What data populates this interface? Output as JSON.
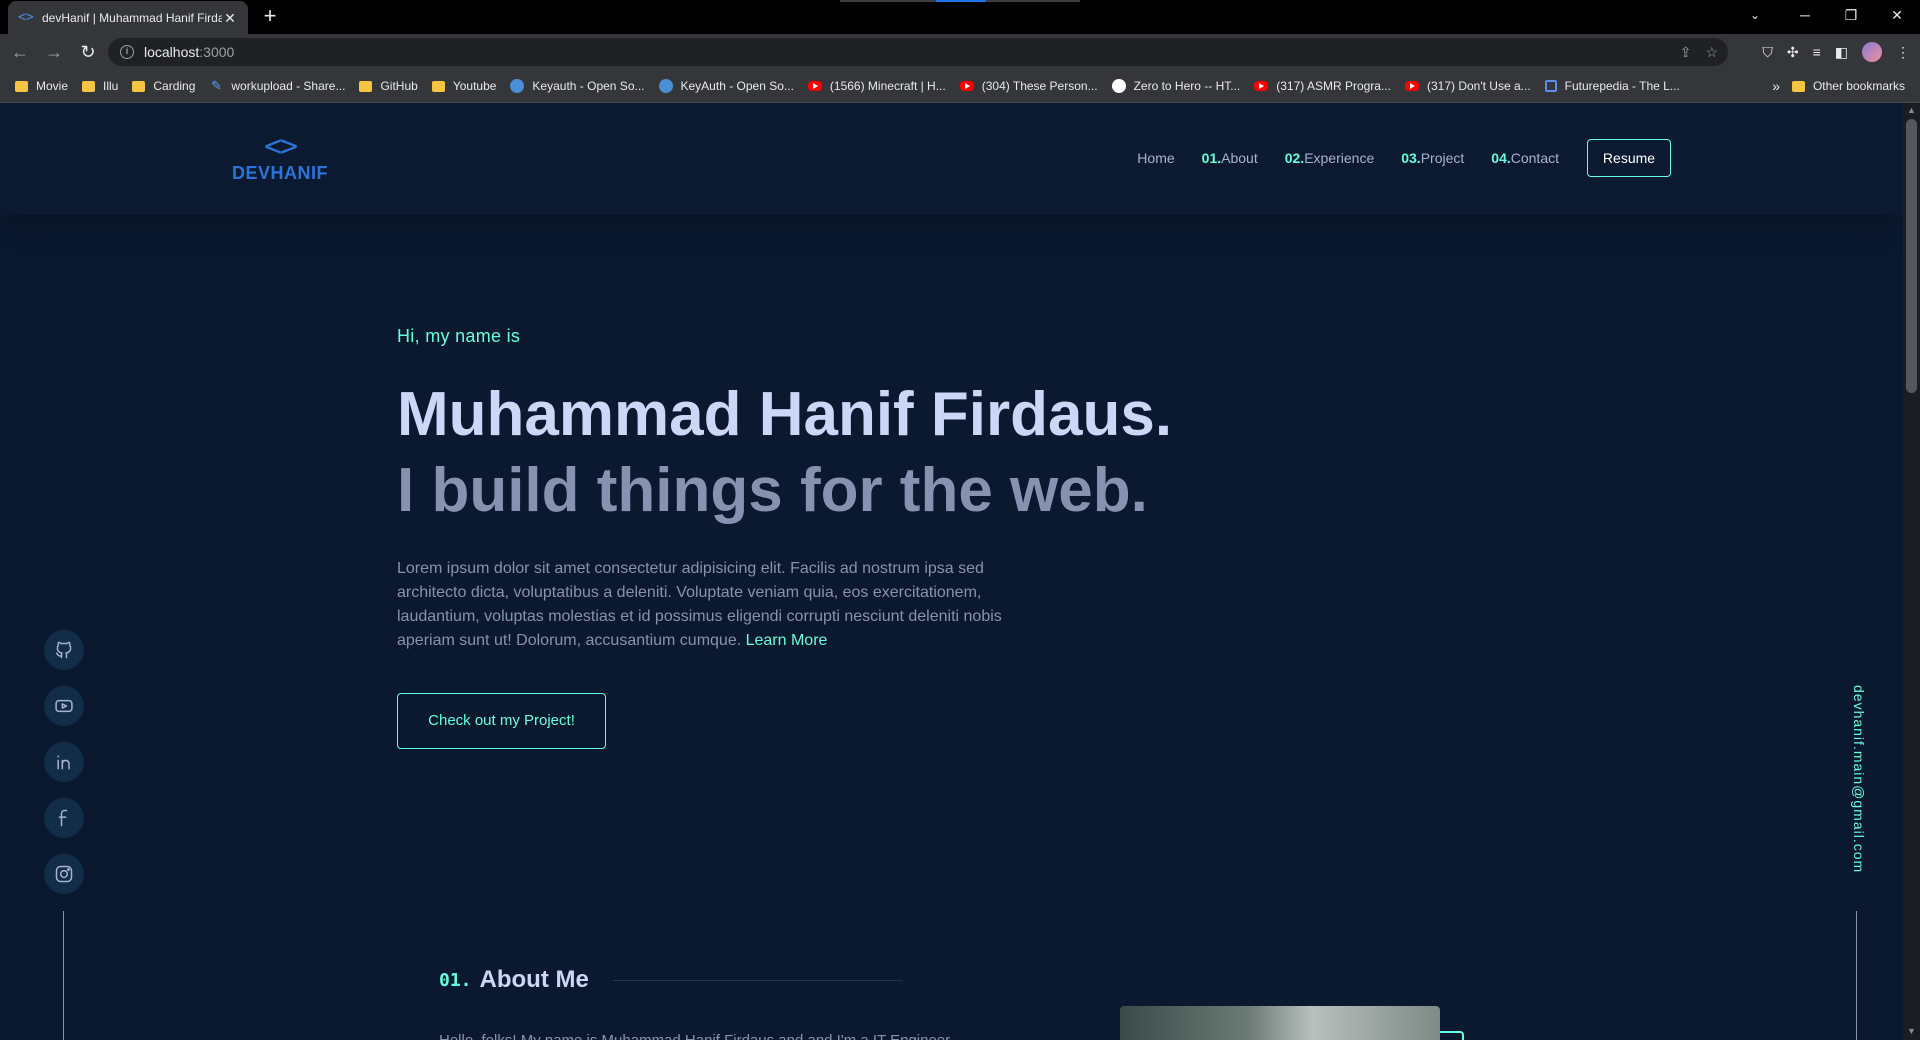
{
  "browser": {
    "tab_title": "devHanif | Muhammad Hanif Firdaus",
    "tab_favicon": "<>",
    "url_host": "localhost",
    "url_port": ":3000",
    "bookmarks": [
      {
        "label": "Movie",
        "icon": "folder-icon"
      },
      {
        "label": "Illu",
        "icon": "folder-icon"
      },
      {
        "label": "Carding",
        "icon": "folder-icon"
      },
      {
        "label": "workupload - Share...",
        "icon": "feather-icon"
      },
      {
        "label": "GitHub",
        "icon": "folder-icon"
      },
      {
        "label": "Youtube",
        "icon": "folder-icon"
      },
      {
        "label": "Keyauth - Open So...",
        "icon": "globe-icon"
      },
      {
        "label": "KeyAuth - Open So...",
        "icon": "globe-icon"
      },
      {
        "label": "(1566) Minecraft | H...",
        "icon": "youtube-icon"
      },
      {
        "label": "(304) These Person...",
        "icon": "youtube-icon"
      },
      {
        "label": "Zero to Hero -- HT...",
        "icon": "github-icon"
      },
      {
        "label": "(317) ASMR Progra...",
        "icon": "youtube-icon"
      },
      {
        "label": "(317) Don't Use a...",
        "icon": "youtube-icon"
      },
      {
        "label": "Futurepedia - The L...",
        "icon": "futurepedia-icon"
      }
    ],
    "bookmarks_more": "»",
    "other_bookmarks": "Other bookmarks"
  },
  "site": {
    "logo_mark": "<>",
    "logo_text": "DEVHANIF",
    "nav": [
      {
        "num": "",
        "label": "Home"
      },
      {
        "num": "01.",
        "label": "About"
      },
      {
        "num": "02.",
        "label": "Experience"
      },
      {
        "num": "03.",
        "label": "Project"
      },
      {
        "num": "04.",
        "label": "Contact"
      }
    ],
    "resume_label": "Resume",
    "accent_color": "#64ffda",
    "background_color": "#0a192f"
  },
  "hero": {
    "greeting": "Hi, my name is",
    "name": "Muhammad Hanif Firdaus.",
    "tagline": "I build things for the web.",
    "intro": "Lorem ipsum dolor sit amet consectetur adipisicing elit. Facilis ad nostrum ipsa sed architecto dicta, voluptatibus a deleniti. Voluptate veniam quia, eos exercitationem, laudantium, voluptas molestias et id possimus eligendi corrupti nesciunt deleniti nobis aperiam sunt ut! Dolorum, accusantium cumque.",
    "learn_more": "Learn More",
    "cta_label": "Check out my Project!"
  },
  "social": [
    "github-icon",
    "youtube-icon",
    "linkedin-icon",
    "facebook-icon",
    "instagram-icon"
  ],
  "email": "devhanif.main@gmail.com",
  "about": {
    "num": "01.",
    "title": "About Me",
    "text_preview": "Hello, folks! My name is Muhammad Hanif Firdaus and and I'm a IT Engineer"
  }
}
